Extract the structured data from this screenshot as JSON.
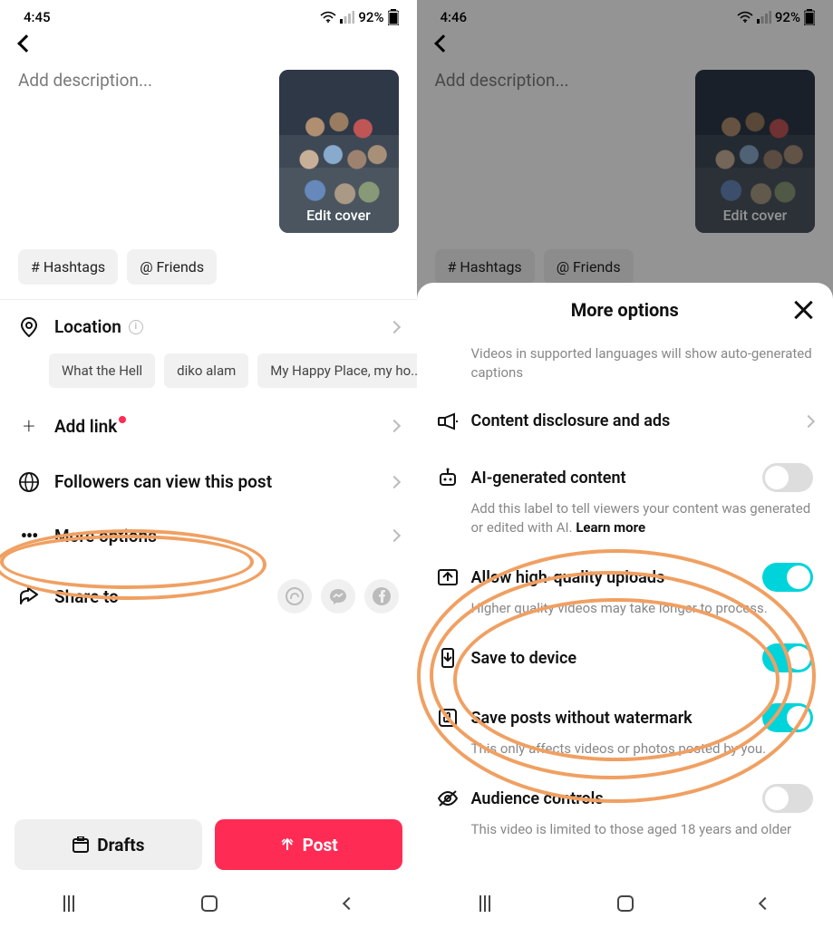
{
  "left": {
    "status": {
      "time": "4:45",
      "battery": "92%"
    },
    "description_placeholder": "Add description...",
    "edit_cover": "Edit cover",
    "chips": {
      "hashtags": "# Hashtags",
      "friends": "@ Friends"
    },
    "location": {
      "label": "Location",
      "suggestions": [
        "What the Hell",
        "diko alam",
        "My Happy Place, my ho..."
      ]
    },
    "add_link": "Add link",
    "privacy": "Followers can view this post",
    "more_options": "More options",
    "share_to": "Share to",
    "drafts": "Drafts",
    "post": "Post"
  },
  "right": {
    "status": {
      "time": "4:46",
      "battery": "92%"
    },
    "description_placeholder": "Add description...",
    "edit_cover": "Edit cover",
    "chips": {
      "hashtags": "# Hashtags",
      "friends": "@ Friends"
    },
    "sheet": {
      "title": "More options",
      "captions_desc": "Videos in supported languages will show auto-generated captions",
      "content_disclosure": "Content disclosure and ads",
      "ai_content": "AI-generated content",
      "ai_content_desc": "Add this label to tell viewers your content was generated or edited with AI. ",
      "learn_more": "Learn more",
      "hq_uploads": "Allow high-quality uploads",
      "hq_uploads_desc": "Higher quality videos may take longer to process.",
      "save_device": "Save to device",
      "save_watermark": "Save posts without watermark",
      "save_watermark_desc": "This only affects videos or photos posted by you.",
      "audience": "Audience controls",
      "audience_desc": "This video is limited to those aged 18 years and older"
    }
  }
}
